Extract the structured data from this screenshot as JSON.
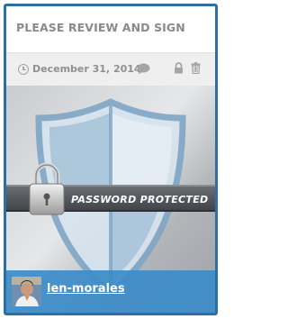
{
  "document": {
    "title": "PLEASE REVIEW AND SIGN",
    "date": "December 31, 2014",
    "thumbnail_label": "PASSWORD PROTECTED"
  },
  "user": {
    "username": "len-morales"
  },
  "icons": {
    "date": "clock-icon",
    "comment": "comment-icon",
    "lock": "lock-icon",
    "delete": "trash-icon"
  },
  "colors": {
    "card_border": "#2f6f9f",
    "user_bar": "#3c8cc8",
    "meta_text": "#8f8f8f"
  }
}
